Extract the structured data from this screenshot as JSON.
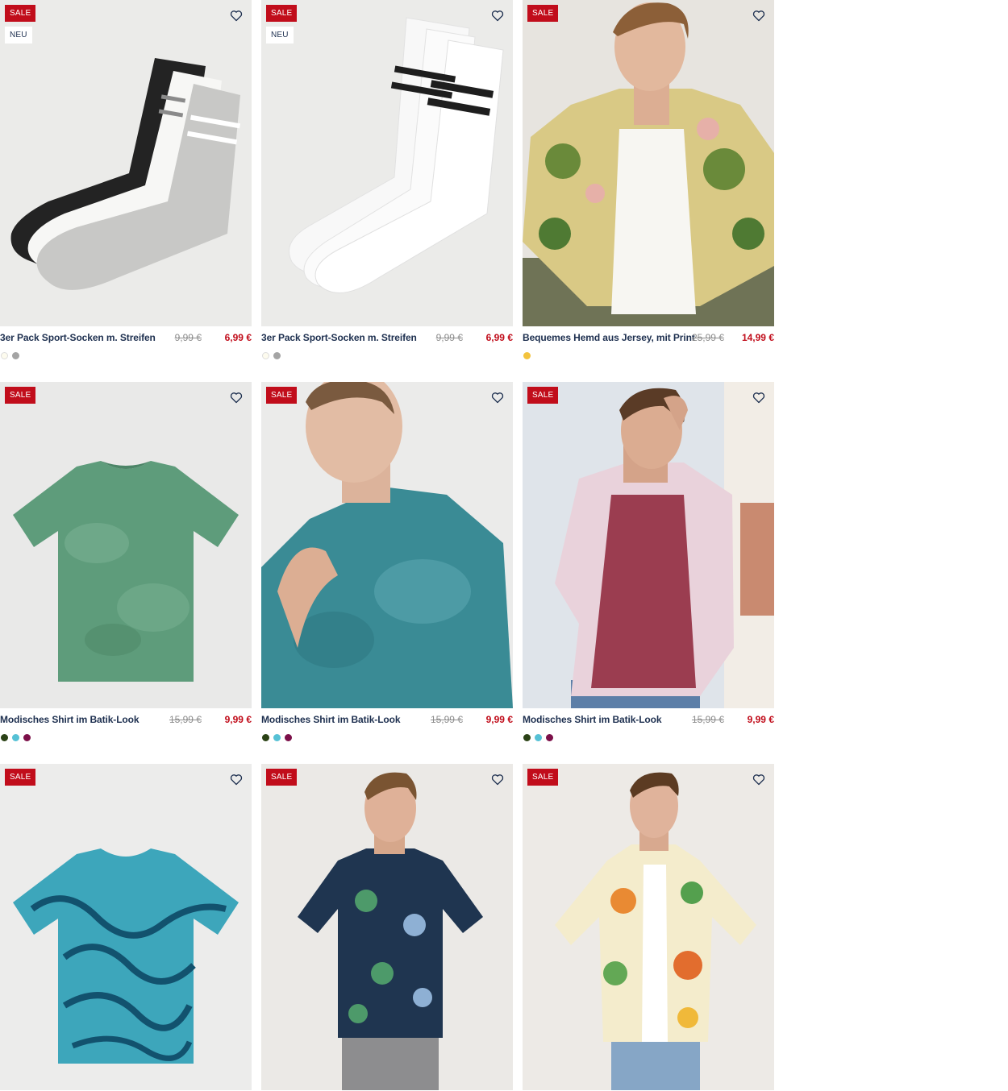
{
  "products": [
    {
      "title": "3er Pack Sport-Socken m. Streifen",
      "old_price": "9,99 €",
      "price": "6,99 €",
      "badges": [
        "SALE",
        "NEU"
      ],
      "colors": [
        "#fdfbee",
        "#a4a4a4"
      ],
      "image": "socks-black-white-grey"
    },
    {
      "title": "3er Pack Sport-Socken m. Streifen",
      "old_price": "9,99 €",
      "price": "6,99 €",
      "badges": [
        "SALE",
        "NEU"
      ],
      "colors": [
        "#fdfbee",
        "#a4a4a4"
      ],
      "image": "socks-white-striped"
    },
    {
      "title": "Bequemes Hemd aus Jersey, mit Print",
      "old_price": "25,99 €",
      "price": "14,99 €",
      "badges": [
        "SALE"
      ],
      "colors": [
        "#f3c33d"
      ],
      "image": "model-tropical-shirt"
    },
    {
      "title": "Modisches Shirt im Batik-Look",
      "old_price": "15,99 €",
      "price": "9,99 €",
      "badges": [
        "SALE"
      ],
      "colors": [
        "#2b4216",
        "#56c1d5",
        "#7c1049"
      ],
      "image": "green-tie-dye-tshirt"
    },
    {
      "title": "Modisches Shirt im Batik-Look",
      "old_price": "15,99 €",
      "price": "9,99 €",
      "badges": [
        "SALE"
      ],
      "colors": [
        "#2b4216",
        "#56c1d5",
        "#7c1049"
      ],
      "image": "model-teal-tie-dye-tshirt"
    },
    {
      "title": "Modisches Shirt im Batik-Look",
      "old_price": "15,99 €",
      "price": "9,99 €",
      "badges": [
        "SALE"
      ],
      "colors": [
        "#2b4216",
        "#56c1d5",
        "#7c1049"
      ],
      "image": "model-plaid-shirt-burgundy-tee"
    },
    {
      "badges": [
        "SALE"
      ],
      "image": "blue-wave-print-tshirt"
    },
    {
      "badges": [
        "SALE"
      ],
      "image": "model-navy-floral-tshirt"
    },
    {
      "badges": [
        "SALE"
      ],
      "image": "model-hawaii-shirt"
    }
  ],
  "icons": {
    "wishlist": "heart-outline-icon"
  },
  "theme": {
    "sale_red": "#c10d1b",
    "text_navy": "#1d2f4f",
    "strike_grey": "#8c8c8c"
  }
}
